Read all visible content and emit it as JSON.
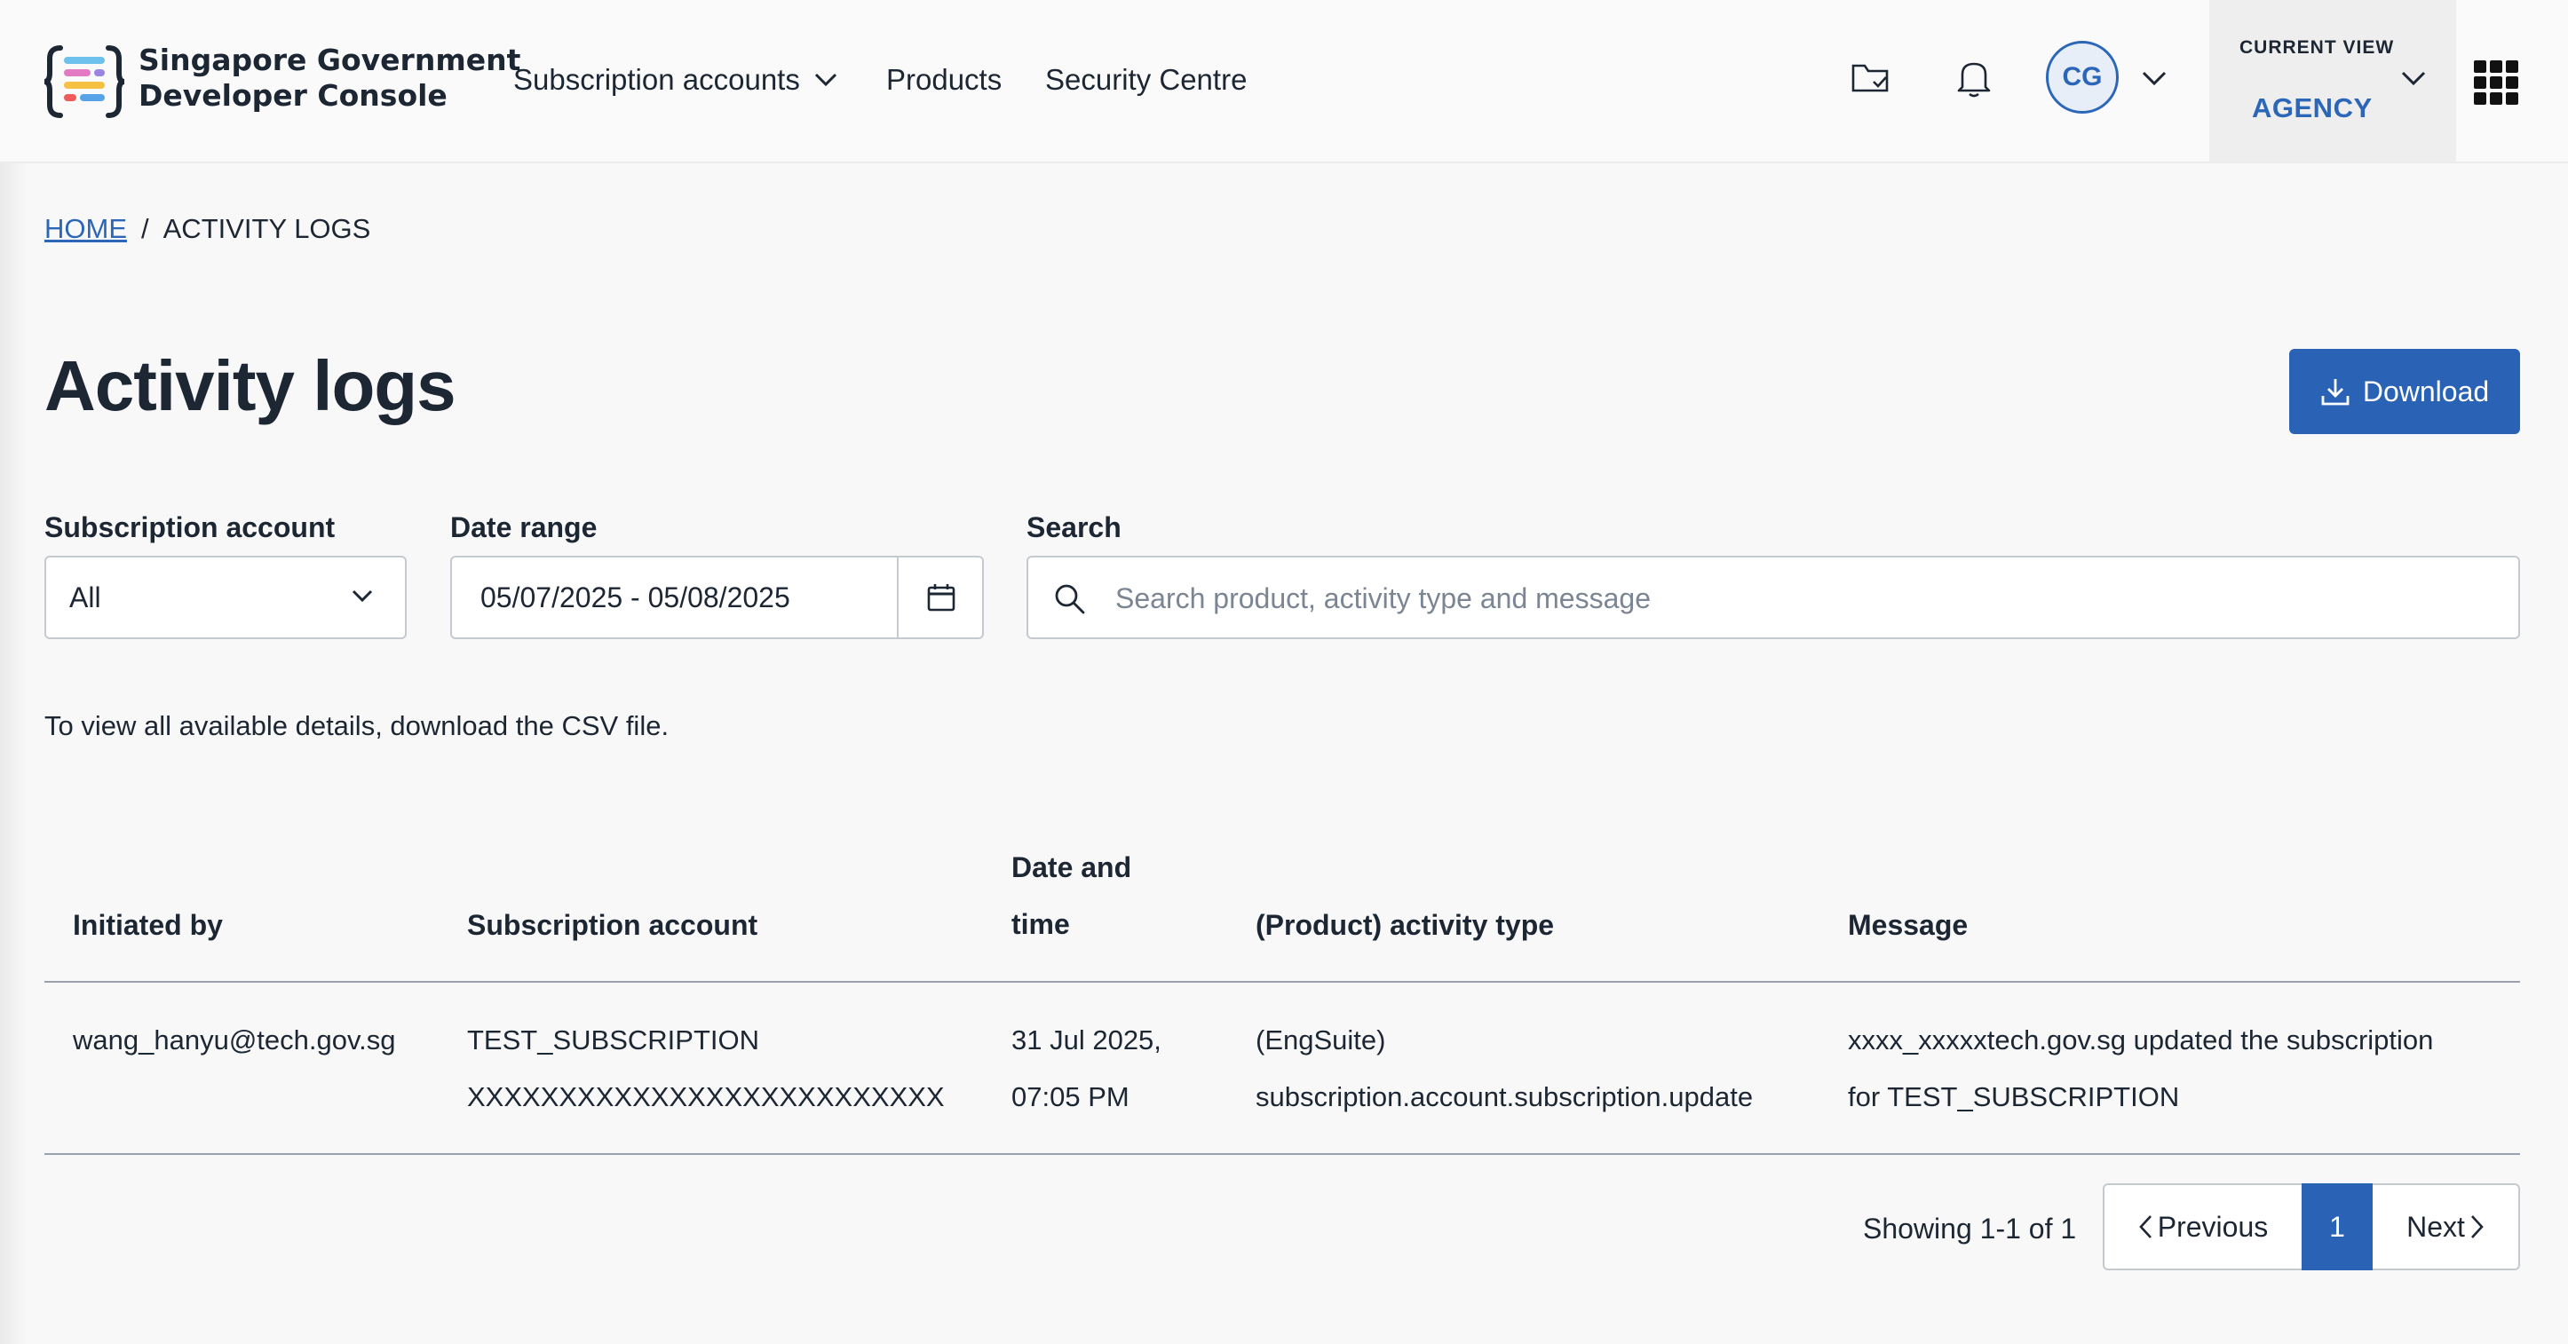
{
  "header": {
    "logo_line1": "Singapore Government",
    "logo_line2": "Developer Console",
    "nav": {
      "subscription_accounts": "Subscription accounts",
      "products": "Products",
      "security_centre": "Security Centre"
    },
    "icons": [
      "folder-check-icon",
      "bell-icon",
      "chevron-down-icon",
      "grid-menu-icon"
    ],
    "avatar_initials": "CG",
    "current_view_label": "CURRENT VIEW",
    "current_view_value": "AGENCY"
  },
  "breadcrumb": {
    "home": "HOME",
    "separator": "/",
    "current": "ACTIVITY LOGS"
  },
  "page": {
    "title": "Activity logs",
    "download_label": "Download"
  },
  "filters": {
    "subscription_label": "Subscription account",
    "subscription_value": "All",
    "date_label": "Date range",
    "date_value": "05/07/2025 - 05/08/2025",
    "search_label": "Search",
    "search_placeholder": "Search product, activity type and message",
    "search_value": ""
  },
  "helper_text": "To view all available details, download the CSV file.",
  "table": {
    "headers": {
      "initiated_by": "Initiated by",
      "subscription_account": "Subscription account",
      "date_time_line1": "Date and",
      "date_time_line2": "time",
      "activity_type": "(Product) activity type",
      "message": "Message"
    },
    "rows": [
      {
        "initiated_by": "wang_hanyu@tech.gov.sg",
        "subscription_line1": "TEST_SUBSCRIPTION",
        "subscription_line2": "XXXXXXXXXXXXXXXXXXXXXXXXXX",
        "date_line1": "31 Jul 2025,",
        "date_line2": "07:05 PM",
        "activity_line1": "(EngSuite)",
        "activity_line2": "subscription.account.subscription.update",
        "message_line1": "xxxx_xxxxxtech.gov.sg updated the subscription",
        "message_line2": "for TEST_SUBSCRIPTION"
      }
    ]
  },
  "pagination": {
    "showing": "Showing 1-1 of 1",
    "previous": "Previous",
    "current_page": "1",
    "next": "Next"
  },
  "colors": {
    "accent": "#2a63b5",
    "text": "#1d2633",
    "background": "#f8f8f9"
  }
}
